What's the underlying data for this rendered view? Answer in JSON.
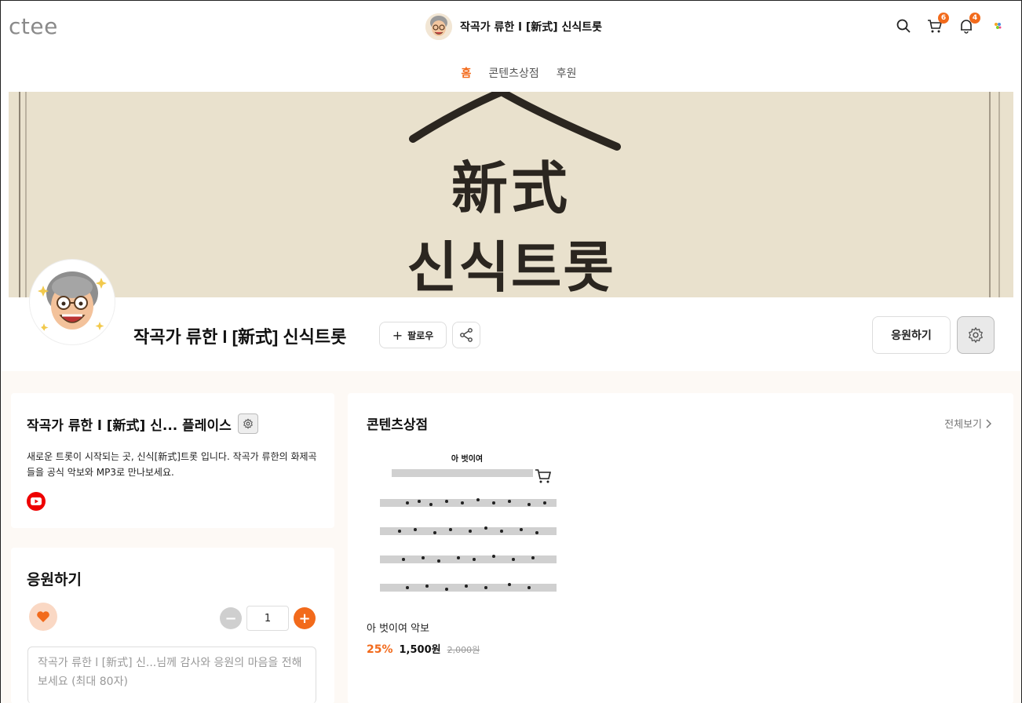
{
  "header": {
    "logo": "ctee",
    "title": "작곡가 류한 l [新式] 신식트롯",
    "cart_count": "6",
    "notification_count": "4"
  },
  "nav": {
    "items": [
      {
        "label": "홈",
        "active": true
      },
      {
        "label": "콘텐츠상점",
        "active": false
      },
      {
        "label": "후원",
        "active": false
      }
    ]
  },
  "banner": {
    "hanja": "新式",
    "hangul": "신식트롯"
  },
  "profile": {
    "name": "작곡가 류한 l [新式] 신식트롯",
    "follow_label": "팔로우",
    "support_label": "응원하기"
  },
  "place": {
    "title": "작곡가 류한 l [新式] 신... 플레이스",
    "description": "새로운 트롯이 시작되는 곳, 신식[新式]트롯 입니다. 작곡가 류한의 화제곡들을 공식 악보와 MP3로 만나보세요."
  },
  "support": {
    "title": "응원하기",
    "quantity": "1",
    "message_placeholder": "작곡가 류한 l [新式] 신...님께 감사와 응원의 마음을 전해보세요 (최대 80자)"
  },
  "store": {
    "title": "콘텐츠상점",
    "view_all": "전체보기",
    "products": [
      {
        "score_title": "아 벗이여",
        "name": "아 벗이여 악보",
        "discount": "25%",
        "price": "1,500원",
        "original_price": "2,000원"
      }
    ]
  },
  "colors": {
    "accent": "#f26a1b",
    "banner_bg": "#ece4d2",
    "youtube": "#e00000"
  }
}
